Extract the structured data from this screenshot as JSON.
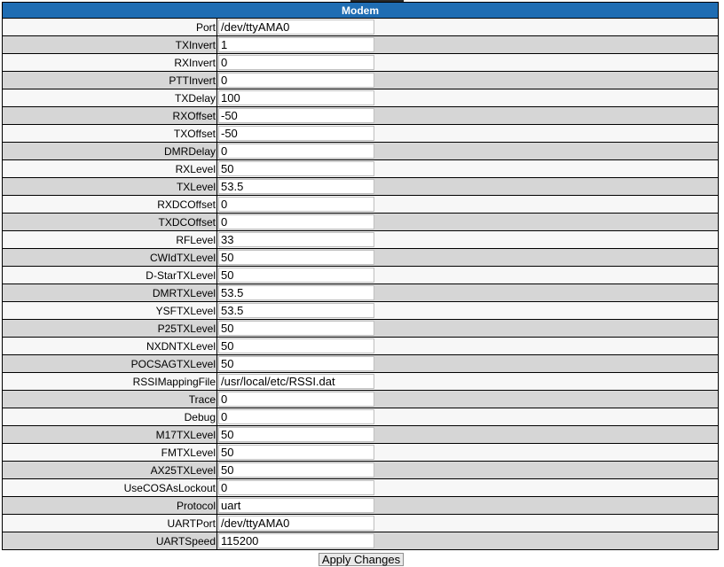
{
  "section": {
    "title": "Modem"
  },
  "rows": [
    {
      "label": "Port",
      "value": "/dev/ttyAMA0"
    },
    {
      "label": "TXInvert",
      "value": "1"
    },
    {
      "label": "RXInvert",
      "value": "0"
    },
    {
      "label": "PTTInvert",
      "value": "0"
    },
    {
      "label": "TXDelay",
      "value": "100"
    },
    {
      "label": "RXOffset",
      "value": "-50"
    },
    {
      "label": "TXOffset",
      "value": "-50"
    },
    {
      "label": "DMRDelay",
      "value": "0"
    },
    {
      "label": "RXLevel",
      "value": "50"
    },
    {
      "label": "TXLevel",
      "value": "53.5"
    },
    {
      "label": "RXDCOffset",
      "value": "0"
    },
    {
      "label": "TXDCOffset",
      "value": "0"
    },
    {
      "label": "RFLevel",
      "value": "33"
    },
    {
      "label": "CWIdTXLevel",
      "value": "50"
    },
    {
      "label": "D-StarTXLevel",
      "value": "50"
    },
    {
      "label": "DMRTXLevel",
      "value": "53.5"
    },
    {
      "label": "YSFTXLevel",
      "value": "53.5"
    },
    {
      "label": "P25TXLevel",
      "value": "50"
    },
    {
      "label": "NXDNTXLevel",
      "value": "50"
    },
    {
      "label": "POCSAGTXLevel",
      "value": "50"
    },
    {
      "label": "RSSIMappingFile",
      "value": "/usr/local/etc/RSSI.dat"
    },
    {
      "label": "Trace",
      "value": "0"
    },
    {
      "label": "Debug",
      "value": "0"
    },
    {
      "label": "M17TXLevel",
      "value": "50"
    },
    {
      "label": "FMTXLevel",
      "value": "50"
    },
    {
      "label": "AX25TXLevel",
      "value": "50"
    },
    {
      "label": "UseCOSAsLockout",
      "value": "0"
    },
    {
      "label": "Protocol",
      "value": "uart"
    },
    {
      "label": "UARTPort",
      "value": "/dev/ttyAMA0"
    },
    {
      "label": "UARTSpeed",
      "value": "115200"
    }
  ],
  "actions": {
    "apply_label": "Apply Changes"
  },
  "colors": {
    "header_bg": "#1f6db3",
    "row_light": "#f7f7f7",
    "row_dark": "#d6d6d6"
  }
}
